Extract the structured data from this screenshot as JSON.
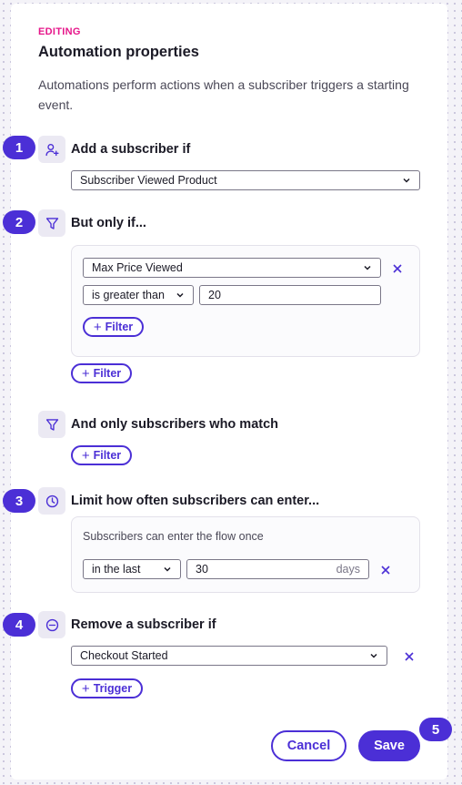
{
  "panel": {
    "tag": "EDITING",
    "title": "Automation properties",
    "description": "Automations perform actions when a subscriber triggers a starting event."
  },
  "steps": [
    "1",
    "2",
    "3",
    "4",
    "5"
  ],
  "trigger": {
    "label": "Add a subscriber if",
    "icon": "add-user-icon",
    "value": "Subscriber Viewed Product"
  },
  "condition": {
    "label": "But only if...",
    "icon": "filter-icon",
    "field": "Max Price Viewed",
    "operator": "is greater than",
    "value": "20",
    "inner_filter_label": "Filter",
    "outer_filter_label": "Filter"
  },
  "audience": {
    "label": "And only subscribers who match",
    "icon": "filter-icon",
    "filter_label": "Filter"
  },
  "limit": {
    "label": "Limit how often subscribers can enter...",
    "icon": "clock-icon",
    "info": "Subscribers can enter the flow once",
    "period": "in the last",
    "value": "30",
    "unit": "days"
  },
  "removal": {
    "label": "Remove a subscriber if",
    "icon": "minus-circle-icon",
    "value": "Checkout Started",
    "trigger_label": "Trigger"
  },
  "actions": {
    "cancel": "Cancel",
    "save": "Save"
  },
  "colors": {
    "accent": "#4b2fd6",
    "tag": "#e6168a"
  }
}
